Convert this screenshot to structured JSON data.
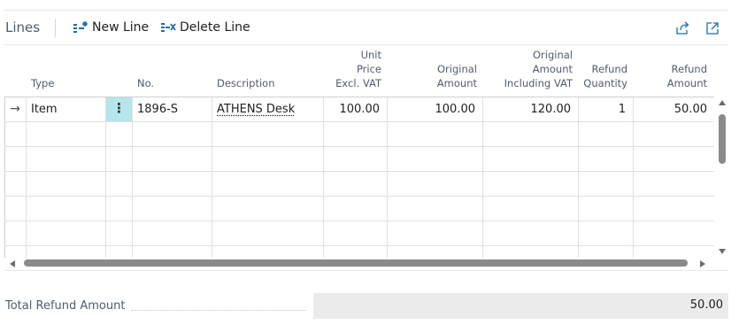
{
  "header": {
    "title": "Lines",
    "new_line_label": "New Line",
    "delete_line_label": "Delete Line"
  },
  "grid": {
    "columns": {
      "type": "Type",
      "no": "No.",
      "description": "Description",
      "unit_price": [
        "Unit",
        "Price",
        "Excl. VAT"
      ],
      "original_amount": [
        "Original",
        "Amount"
      ],
      "original_amount_incl_vat": [
        "Original",
        "Amount",
        "Including VAT"
      ],
      "refund_quantity": [
        "Refund",
        "Quantity"
      ],
      "refund_amount": [
        "Refund",
        "Amount"
      ]
    },
    "rows": [
      {
        "type": "Item",
        "no": "1896-S",
        "description": "ATHENS Desk",
        "unit_price": "100.00",
        "original_amount": "100.00",
        "original_amount_incl_vat": "120.00",
        "refund_quantity": "1",
        "refund_amount": "50.00"
      }
    ],
    "row_menu_glyph": "⋮",
    "current_row_glyph": "→",
    "vertical_scroll_position": 0,
    "horizontal_scroll_position": 0
  },
  "footer": {
    "total_label": "Total Refund Amount",
    "total_value": "50.00"
  },
  "colors": {
    "selected_cell": "#b5e6ec",
    "header_text": "#505c6d",
    "total_box": "#ebebeb"
  },
  "icons": {
    "new_line": "new-line-icon",
    "delete_line": "delete-line-icon",
    "share": "share-icon",
    "expand": "expand-icon"
  }
}
